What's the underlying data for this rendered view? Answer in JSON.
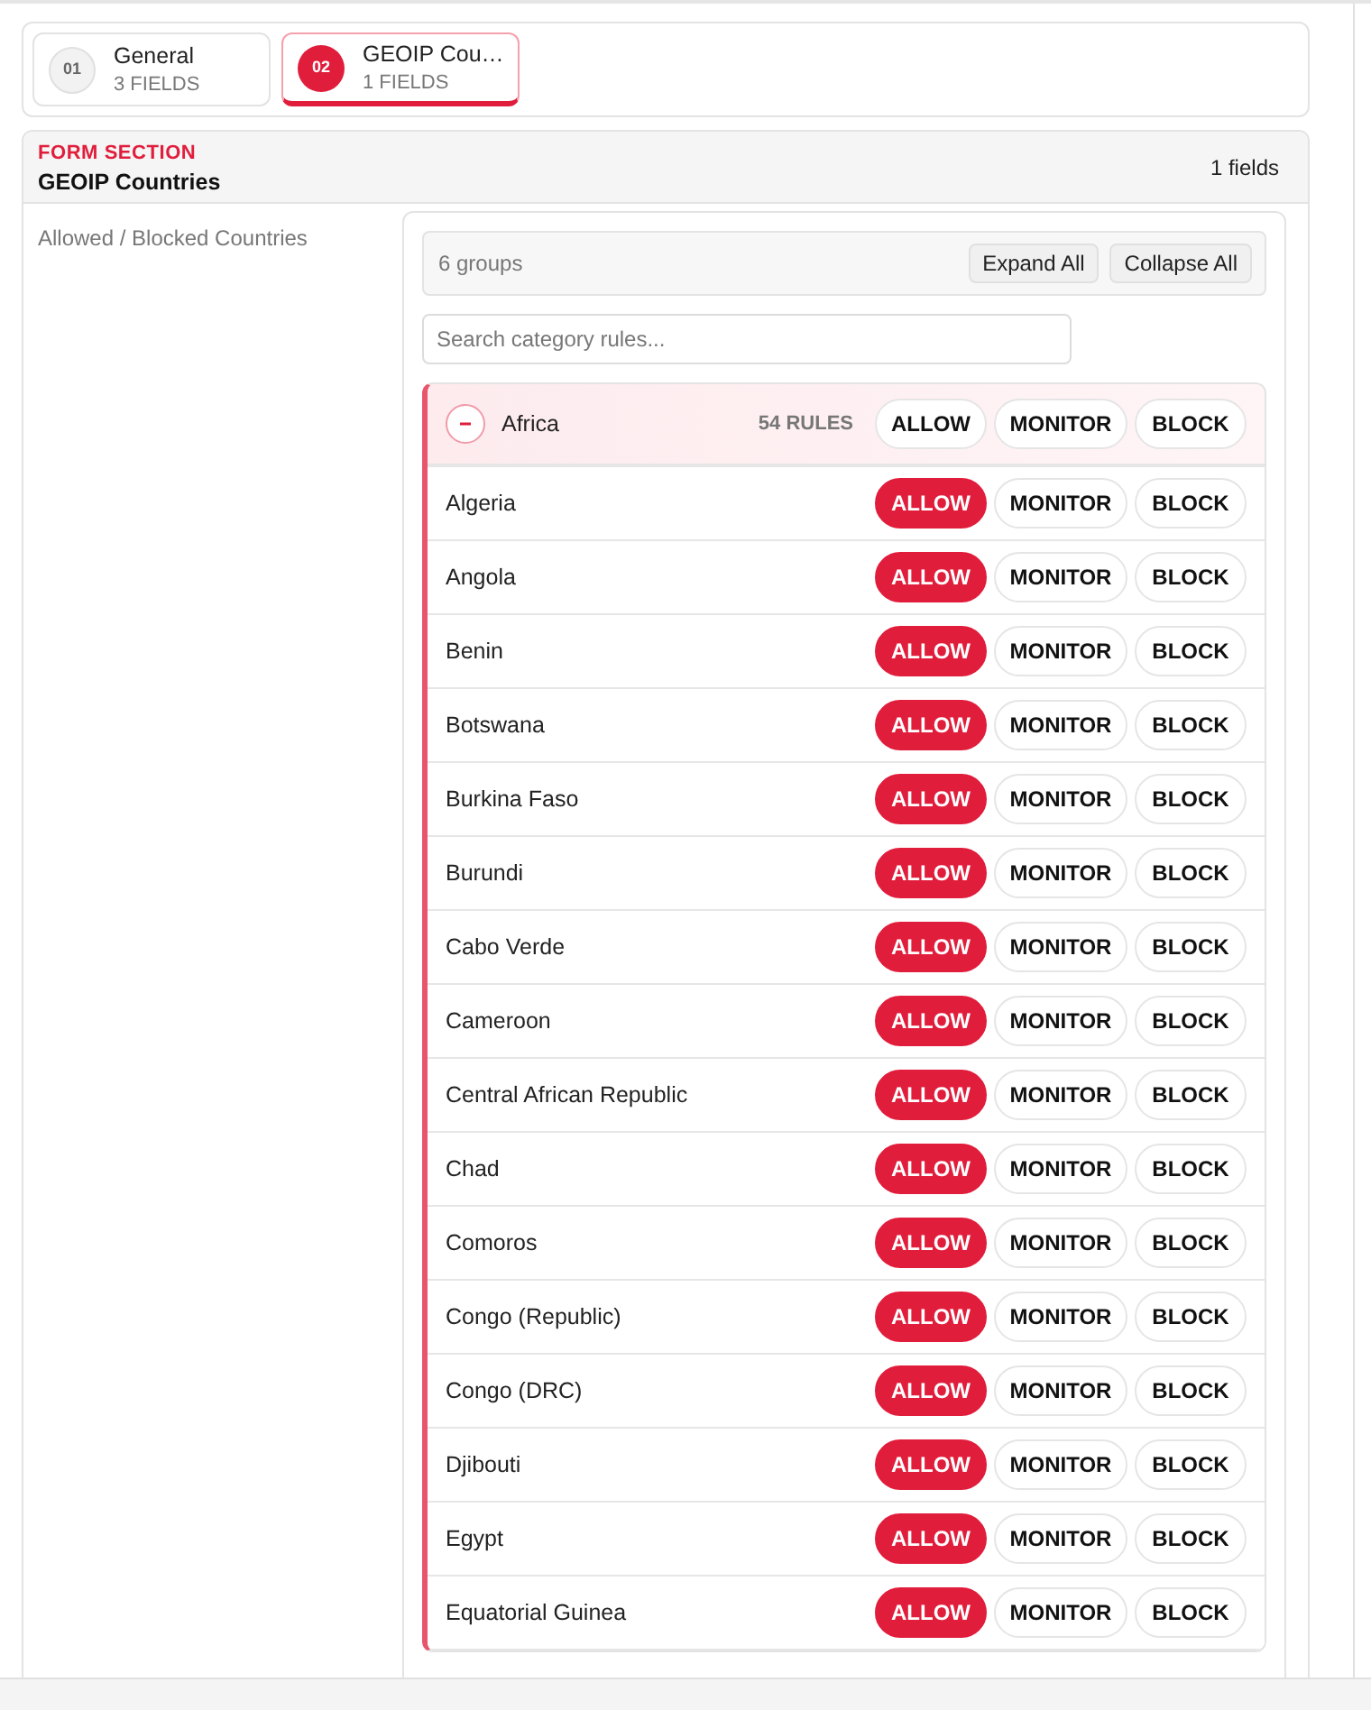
{
  "steps": [
    {
      "number": "01",
      "title": "General",
      "subtitle": "3 FIELDS",
      "selected": false
    },
    {
      "number": "02",
      "title": "GEOIP Cou…",
      "subtitle": "1 FIELDS",
      "selected": true
    }
  ],
  "section": {
    "eyebrow": "FORM SECTION",
    "title": "GEOIP Countries",
    "count": "1 fields",
    "field_label": "Allowed / Blocked Countries"
  },
  "toolbar": {
    "groups": "6 groups",
    "buttons": [
      "Expand All",
      "Collapse All"
    ]
  },
  "search": {
    "placeholder": "Search category rules..."
  },
  "group": {
    "name": "Africa",
    "expanded": true,
    "count": "54 RULES",
    "actions": [
      {
        "label": "ALLOW",
        "selected": false
      },
      {
        "label": "MONITOR",
        "selected": false
      },
      {
        "label": "BLOCK",
        "selected": false
      }
    ],
    "rows": [
      {
        "name": "Algeria",
        "actions": [
          {
            "label": "ALLOW",
            "selected": true
          },
          {
            "label": "MONITOR",
            "selected": false
          },
          {
            "label": "BLOCK",
            "selected": false
          }
        ]
      },
      {
        "name": "Angola",
        "actions": [
          {
            "label": "ALLOW",
            "selected": true
          },
          {
            "label": "MONITOR",
            "selected": false
          },
          {
            "label": "BLOCK",
            "selected": false
          }
        ]
      },
      {
        "name": "Benin",
        "actions": [
          {
            "label": "ALLOW",
            "selected": true
          },
          {
            "label": "MONITOR",
            "selected": false
          },
          {
            "label": "BLOCK",
            "selected": false
          }
        ]
      },
      {
        "name": "Botswana",
        "actions": [
          {
            "label": "ALLOW",
            "selected": true
          },
          {
            "label": "MONITOR",
            "selected": false
          },
          {
            "label": "BLOCK",
            "selected": false
          }
        ]
      },
      {
        "name": "Burkina Faso",
        "actions": [
          {
            "label": "ALLOW",
            "selected": true
          },
          {
            "label": "MONITOR",
            "selected": false
          },
          {
            "label": "BLOCK",
            "selected": false
          }
        ]
      },
      {
        "name": "Burundi",
        "actions": [
          {
            "label": "ALLOW",
            "selected": true
          },
          {
            "label": "MONITOR",
            "selected": false
          },
          {
            "label": "BLOCK",
            "selected": false
          }
        ]
      },
      {
        "name": "Cabo Verde",
        "actions": [
          {
            "label": "ALLOW",
            "selected": true
          },
          {
            "label": "MONITOR",
            "selected": false
          },
          {
            "label": "BLOCK",
            "selected": false
          }
        ]
      },
      {
        "name": "Cameroon",
        "actions": [
          {
            "label": "ALLOW",
            "selected": true
          },
          {
            "label": "MONITOR",
            "selected": false
          },
          {
            "label": "BLOCK",
            "selected": false
          }
        ]
      },
      {
        "name": "Central African Republic",
        "actions": [
          {
            "label": "ALLOW",
            "selected": true
          },
          {
            "label": "MONITOR",
            "selected": false
          },
          {
            "label": "BLOCK",
            "selected": false
          }
        ]
      },
      {
        "name": "Chad",
        "actions": [
          {
            "label": "ALLOW",
            "selected": true
          },
          {
            "label": "MONITOR",
            "selected": false
          },
          {
            "label": "BLOCK",
            "selected": false
          }
        ]
      },
      {
        "name": "Comoros",
        "actions": [
          {
            "label": "ALLOW",
            "selected": true
          },
          {
            "label": "MONITOR",
            "selected": false
          },
          {
            "label": "BLOCK",
            "selected": false
          }
        ]
      },
      {
        "name": "Congo (Republic)",
        "actions": [
          {
            "label": "ALLOW",
            "selected": true
          },
          {
            "label": "MONITOR",
            "selected": false
          },
          {
            "label": "BLOCK",
            "selected": false
          }
        ]
      },
      {
        "name": "Congo (DRC)",
        "actions": [
          {
            "label": "ALLOW",
            "selected": true
          },
          {
            "label": "MONITOR",
            "selected": false
          },
          {
            "label": "BLOCK",
            "selected": false
          }
        ]
      },
      {
        "name": "Djibouti",
        "actions": [
          {
            "label": "ALLOW",
            "selected": true
          },
          {
            "label": "MONITOR",
            "selected": false
          },
          {
            "label": "BLOCK",
            "selected": false
          }
        ]
      },
      {
        "name": "Egypt",
        "actions": [
          {
            "label": "ALLOW",
            "selected": true
          },
          {
            "label": "MONITOR",
            "selected": false
          },
          {
            "label": "BLOCK",
            "selected": false
          }
        ]
      },
      {
        "name": "Equatorial Guinea",
        "actions": [
          {
            "label": "ALLOW",
            "selected": true
          },
          {
            "label": "MONITOR",
            "selected": false
          },
          {
            "label": "BLOCK",
            "selected": false
          }
        ]
      }
    ]
  }
}
